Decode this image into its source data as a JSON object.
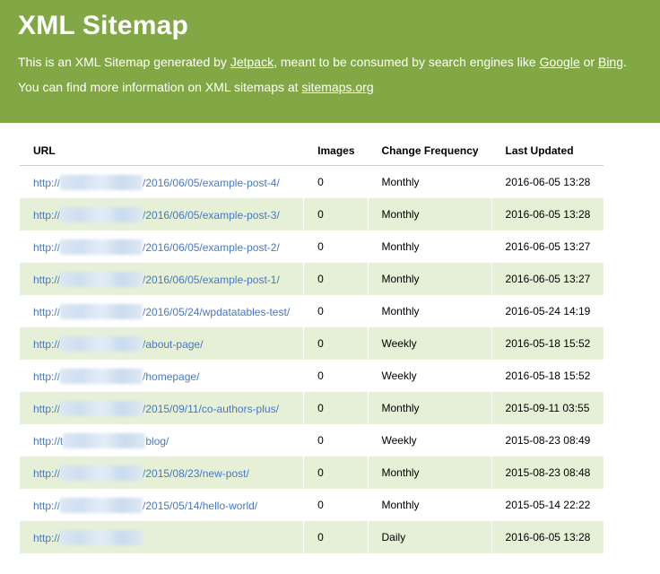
{
  "header": {
    "title": "XML Sitemap",
    "intro_line1": {
      "text1": "This is an XML Sitemap generated by ",
      "link_jetpack": "Jetpack",
      "text2": ", meant to be consumed by search engines like ",
      "link_google": "Google",
      "text3": " or ",
      "link_bing": "Bing",
      "text4": "."
    },
    "intro_line2": {
      "text1": "You can find more information on XML sitemaps at ",
      "link_sitemaps": "sitemaps.org"
    }
  },
  "table": {
    "columns": [
      "URL",
      "Images",
      "Change Frequency",
      "Last Updated"
    ],
    "rows": [
      {
        "url_prefix": "http://",
        "url_suffix": "/2016/06/05/example-post-4/",
        "images": "0",
        "frequency": "Monthly",
        "updated": "2016-06-05 13:28"
      },
      {
        "url_prefix": "http://",
        "url_suffix": "/2016/06/05/example-post-3/",
        "images": "0",
        "frequency": "Monthly",
        "updated": "2016-06-05 13:28"
      },
      {
        "url_prefix": "http://",
        "url_suffix": "/2016/06/05/example-post-2/",
        "images": "0",
        "frequency": "Monthly",
        "updated": "2016-06-05 13:27"
      },
      {
        "url_prefix": "http://",
        "url_suffix": "/2016/06/05/example-post-1/",
        "images": "0",
        "frequency": "Monthly",
        "updated": "2016-06-05 13:27"
      },
      {
        "url_prefix": "http://",
        "url_suffix": "/2016/05/24/wpdatatables-test/",
        "images": "0",
        "frequency": "Monthly",
        "updated": "2016-05-24 14:19"
      },
      {
        "url_prefix": "http://",
        "url_suffix": "/about-page/",
        "images": "0",
        "frequency": "Weekly",
        "updated": "2016-05-18 15:52"
      },
      {
        "url_prefix": "http://",
        "url_suffix": "/homepage/",
        "images": "0",
        "frequency": "Weekly",
        "updated": "2016-05-18 15:52"
      },
      {
        "url_prefix": "http://",
        "url_suffix": "/2015/09/11/co-authors-plus/",
        "images": "0",
        "frequency": "Monthly",
        "updated": "2015-09-11 03:55"
      },
      {
        "url_prefix": "http://t",
        "url_suffix": "blog/",
        "images": "0",
        "frequency": "Weekly",
        "updated": "2015-08-23 08:49"
      },
      {
        "url_prefix": "http://",
        "url_suffix": "/2015/08/23/new-post/",
        "images": "0",
        "frequency": "Monthly",
        "updated": "2015-08-23 08:48"
      },
      {
        "url_prefix": "http://",
        "url_suffix": "/2015/05/14/hello-world/",
        "images": "0",
        "frequency": "Monthly",
        "updated": "2015-05-14 22:22"
      },
      {
        "url_prefix": "http://",
        "url_suffix": "",
        "images": "0",
        "frequency": "Daily",
        "updated": "2016-06-05 13:28"
      }
    ]
  },
  "colors": {
    "header_bg": "#82a745",
    "row_alt_bg": "#e6f0d6",
    "link": "#4978c2"
  }
}
